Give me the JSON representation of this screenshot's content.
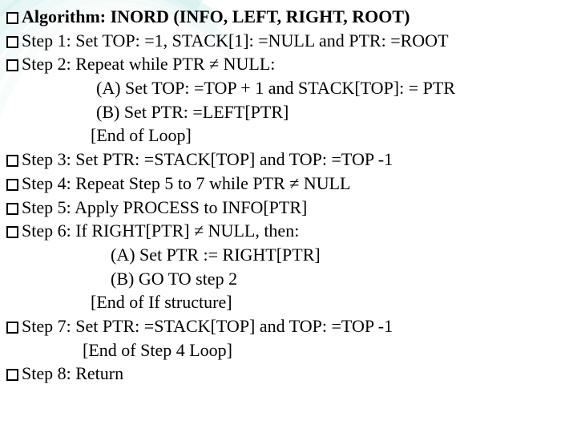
{
  "lines": [
    {
      "bullet": true,
      "bold": true,
      "indent": "",
      "text": "Algorithm: INORD (INFO, LEFT, RIGHT, ROOT)"
    },
    {
      "bullet": true,
      "bold": false,
      "indent": "",
      "text": "Step 1: Set TOP: =1, STACK[1]: =NULL and PTR: =ROOT"
    },
    {
      "bullet": true,
      "bold": false,
      "indent": "",
      "text": "Step 2: Repeat while  PTR ≠ NULL:"
    },
    {
      "bullet": false,
      "bold": false,
      "indent": "indent1",
      "text": "(A) Set TOP: =TOP + 1 and STACK[TOP]: = PTR"
    },
    {
      "bullet": false,
      "bold": false,
      "indent": "indent1",
      "text": "(B) Set PTR: =LEFT[PTR]"
    },
    {
      "bullet": false,
      "bold": false,
      "indent": "indent3",
      "text": "[End of Loop]"
    },
    {
      "bullet": true,
      "bold": false,
      "indent": "",
      "text": "Step 3: Set PTR: =STACK[TOP] and TOP: =TOP -1"
    },
    {
      "bullet": true,
      "bold": false,
      "indent": "",
      "text": "Step 4: Repeat Step 5 to 7 while PTR ≠ NULL"
    },
    {
      "bullet": true,
      "bold": false,
      "indent": "",
      "text": "Step 5: Apply PROCESS to INFO[PTR]"
    },
    {
      "bullet": true,
      "bold": false,
      "indent": "",
      "text": "Step 6: If RIGHT[PTR] ≠ NULL, then:"
    },
    {
      "bullet": false,
      "bold": false,
      "indent": "indent2",
      "text": "(A) Set PTR := RIGHT[PTR]"
    },
    {
      "bullet": false,
      "bold": false,
      "indent": "indent2",
      "text": "(B) GO TO step 2"
    },
    {
      "bullet": false,
      "bold": false,
      "indent": "indent3",
      "text": "[End of If structure]"
    },
    {
      "bullet": true,
      "bold": false,
      "indent": "",
      "text": "Step 7: Set PTR: =STACK[TOP] and TOP: =TOP -1"
    },
    {
      "bullet": false,
      "bold": false,
      "indent": "indent4",
      "text": "[End of Step 4 Loop]"
    },
    {
      "bullet": true,
      "bold": false,
      "indent": "sp-left",
      "text": " Step 8: Return"
    }
  ]
}
